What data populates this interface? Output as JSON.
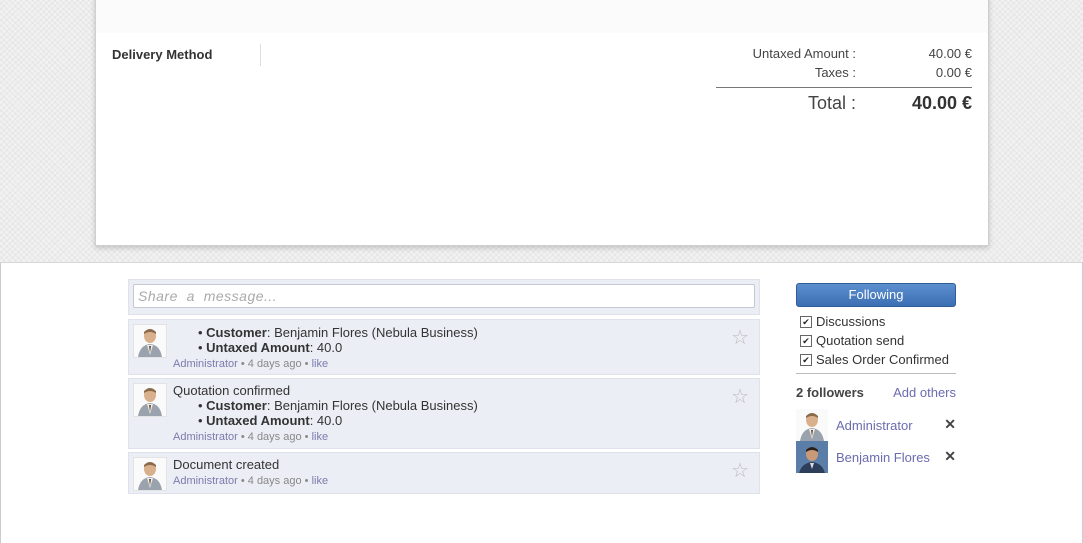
{
  "order": {
    "delivery_label": "Delivery Method",
    "untaxed_label": "Untaxed Amount :",
    "untaxed_value": "40.00 €",
    "taxes_label": "Taxes :",
    "taxes_value": "0.00 €",
    "total_label": "Total :",
    "total_value": "40.00 €"
  },
  "compose": {
    "placeholder": "Share  a  message..."
  },
  "messages": [
    {
      "title": "",
      "lines": [
        {
          "key": "Customer",
          "value": ": Benjamin Flores (Nebula Business)"
        },
        {
          "key": "Untaxed Amount",
          "value": ": 40.0"
        }
      ],
      "author": "Administrator",
      "sep1": " • ",
      "time": "4 days ago",
      "sep2": " • ",
      "like": "like"
    },
    {
      "title": "Quotation confirmed",
      "lines": [
        {
          "key": "Customer",
          "value": ": Benjamin Flores (Nebula Business)"
        },
        {
          "key": "Untaxed Amount",
          "value": ": 40.0"
        }
      ],
      "author": "Administrator",
      "sep1": " • ",
      "time": "4 days ago",
      "sep2": " • ",
      "like": "like"
    },
    {
      "title": "Document created",
      "lines": [],
      "author": "Administrator",
      "sep1": " • ",
      "time": "4 days ago",
      "sep2": " • ",
      "like": "like"
    }
  ],
  "star_icon": "☆",
  "followers": {
    "button_label": "Following",
    "subtypes": [
      {
        "label": "Discussions",
        "checked": true
      },
      {
        "label": "Quotation send",
        "checked": true
      },
      {
        "label": "Sales Order Confirmed",
        "checked": true
      }
    ],
    "count_label": "2 followers",
    "add_label": "Add others",
    "people": [
      {
        "name": "Administrator",
        "remove": "✕"
      },
      {
        "name": "Benjamin Flores",
        "remove": "✕"
      }
    ]
  },
  "check_glyph": "✔"
}
